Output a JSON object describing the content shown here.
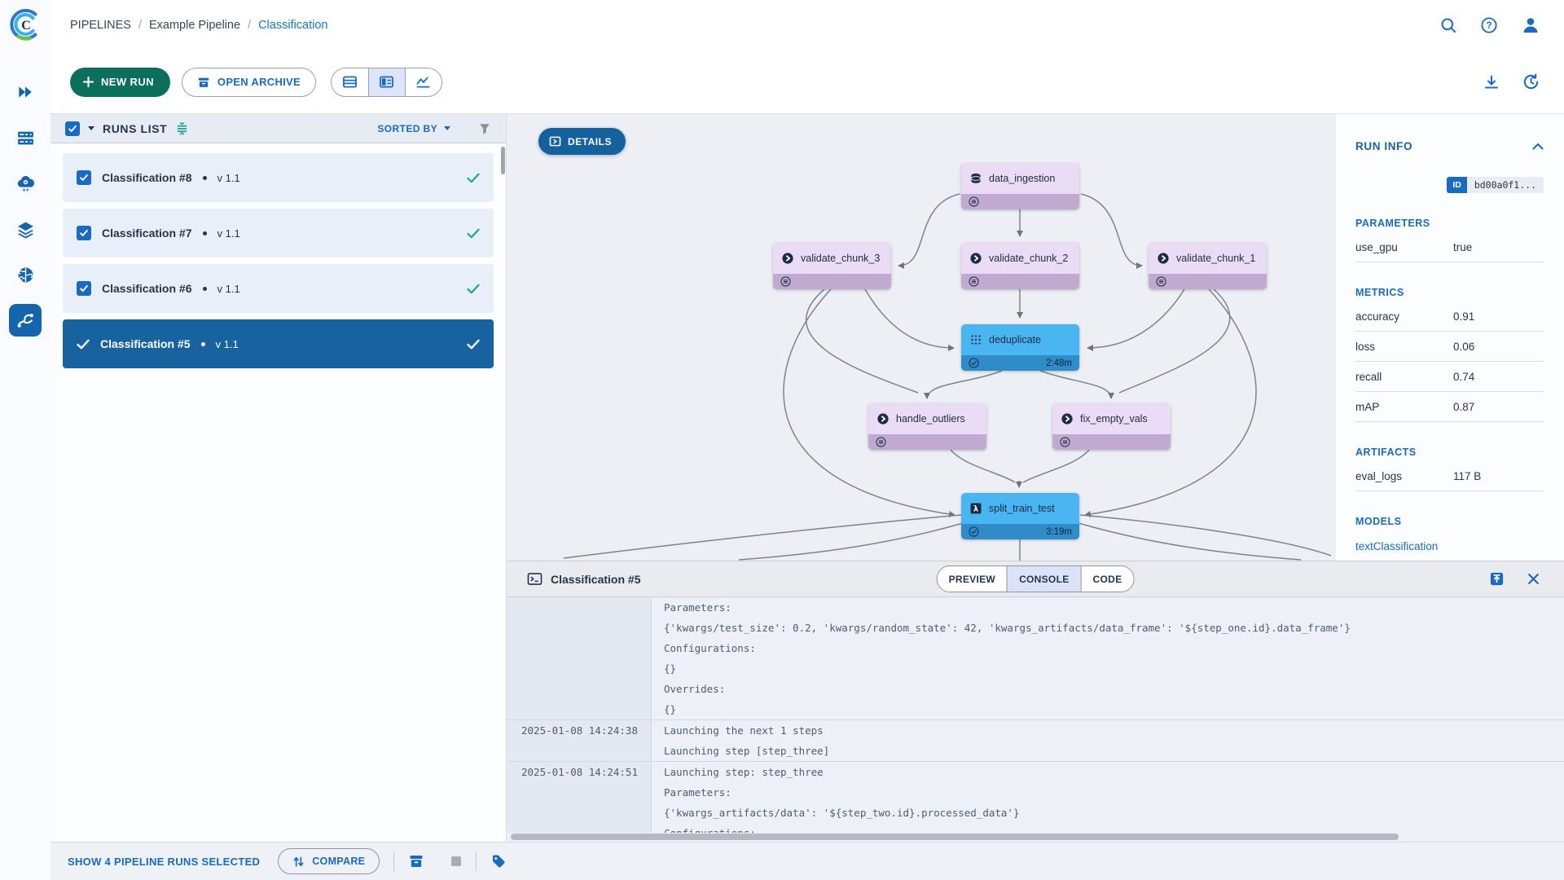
{
  "header": {
    "breadcrumb": [
      "PIPELINES",
      "Example Pipeline",
      "Classification"
    ]
  },
  "toolbar": {
    "new_run_label": "NEW RUN",
    "open_archive_label": "OPEN ARCHIVE"
  },
  "runs_list": {
    "title": "RUNS LIST",
    "sorted_by_label": "SORTED BY",
    "items": [
      {
        "name": "Classification #8",
        "version": "v 1.1",
        "selected": false,
        "checked": true
      },
      {
        "name": "Classification #7",
        "version": "v 1.1",
        "selected": false,
        "checked": true
      },
      {
        "name": "Classification #6",
        "version": "v 1.1",
        "selected": false,
        "checked": true
      },
      {
        "name": "Classification #5",
        "version": "v 1.1",
        "selected": true,
        "checked": true
      }
    ]
  },
  "graph": {
    "details_label": "DETAILS",
    "nodes": [
      {
        "name": "data_ingestion",
        "icon": "dataset",
        "state": "pending"
      },
      {
        "name": "validate_chunk_3",
        "icon": "chevron",
        "state": "pending"
      },
      {
        "name": "validate_chunk_2",
        "icon": "chevron",
        "state": "pending"
      },
      {
        "name": "validate_chunk_1",
        "icon": "chevron",
        "state": "pending"
      },
      {
        "name": "deduplicate",
        "icon": "grid",
        "state": "completed",
        "time": "2:48m"
      },
      {
        "name": "handle_outliers",
        "icon": "chevron",
        "state": "pending"
      },
      {
        "name": "fix_empty_vals",
        "icon": "chevron",
        "state": "pending"
      },
      {
        "name": "split_train_test",
        "icon": "lambda",
        "state": "completed",
        "time": "3:19m"
      }
    ]
  },
  "run_info": {
    "title": "RUN INFO",
    "id_label": "ID",
    "id_value": "bd00a0f1...",
    "sections": [
      {
        "title": "PARAMETERS",
        "rows": [
          [
            "use_gpu",
            "true"
          ]
        ]
      },
      {
        "title": "METRICS",
        "rows": [
          [
            "accuracy",
            "0.91"
          ],
          [
            "loss",
            "0.06"
          ],
          [
            "recall",
            "0.74"
          ],
          [
            "mAP",
            "0.87"
          ]
        ]
      },
      {
        "title": "ARTIFACTS",
        "rows": [
          [
            "eval_logs",
            "117 B"
          ]
        ]
      },
      {
        "title": "MODELS",
        "rows": [],
        "link": "textClassification"
      }
    ]
  },
  "console": {
    "title": "Classification #5",
    "tabs": [
      "PREVIEW",
      "CONSOLE",
      "CODE"
    ],
    "active_tab": "CONSOLE",
    "entries": [
      {
        "timestamp": "",
        "lines": [
          "Parameters:",
          "{'kwargs/test_size': 0.2, 'kwargs/random_state': 42, 'kwargs_artifacts/data_frame': '${step_one.id}.data_frame'}",
          "Configurations:",
          "{}",
          "Overrides:",
          "{}"
        ]
      },
      {
        "timestamp": "2025-01-08 14:24:38",
        "lines": [
          "Launching the next 1 steps",
          "Launching step [step_three]"
        ]
      },
      {
        "timestamp": "2025-01-08 14:24:51",
        "lines": [
          "Launching step: step_three",
          "Parameters:",
          "{'kwargs_artifacts/data': '${step_two.id}.processed_data'}",
          "Configurations:"
        ]
      }
    ]
  },
  "footer": {
    "selected_label": "SHOW 4 PIPELINE RUNS SELECTED",
    "compare_label": "COMPARE"
  },
  "colors": {
    "primary_blue": "#1a6ac0",
    "selected_row": "#17629f",
    "new_run_green": "#0b6f5b",
    "teal_check": "#2aa796",
    "node_purple": "#e9dcf4",
    "node_blue": "#49b5f1"
  }
}
